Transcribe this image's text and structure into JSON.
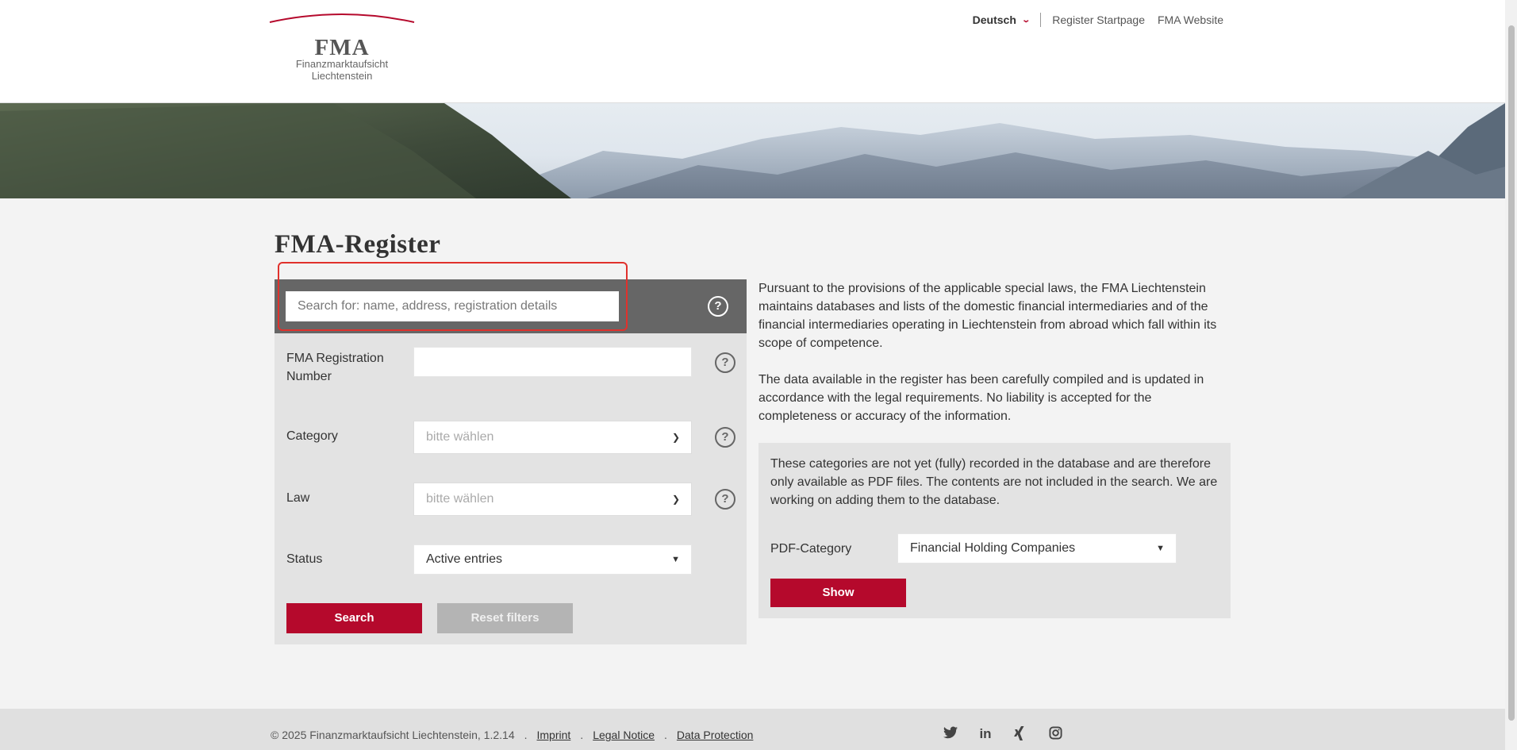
{
  "header": {
    "logo_text": "FMA",
    "logo_subtitle_line1": "Finanzmarktaufsicht",
    "logo_subtitle_line2": "Liechtenstein",
    "language": "Deutsch",
    "nav": [
      "Register Startpage",
      "FMA Website"
    ]
  },
  "main": {
    "title": "FMA-Register",
    "search": {
      "placeholder": "Search for: name, address, registration details",
      "value": ""
    },
    "filters": {
      "registration_label": "FMA Registration Number",
      "registration_value": "",
      "category_label": "Category",
      "category_value": "bitte wählen",
      "law_label": "Law",
      "law_value": "bitte wählen",
      "status_label": "Status",
      "status_value": "Active entries",
      "search_button": "Search",
      "reset_button": "Reset filters"
    },
    "info": {
      "paragraph1": "Pursuant to the provisions of the applicable special laws, the FMA Liechtenstein maintains databases and lists of the domestic financial intermediaries and of the financial intermediaries operating in Liechtenstein from abroad which fall within its scope of competence.",
      "paragraph2": "The data available in the register has been carefully compiled and is updated in accordance with the legal requirements. No liability is accepted for the completeness or accuracy of the information."
    },
    "pdf": {
      "text": "These categories are not yet (fully) recorded in the database and are therefore only available as PDF files. The contents are not included in the search. We are working on adding them to the database.",
      "label": "PDF-Category",
      "value": "Financial Holding Companies",
      "show_button": "Show"
    }
  },
  "footer": {
    "copyright": "© 2025 Finanzmarktaufsicht Liechtenstein, 1.2.14",
    "links": [
      "Imprint",
      "Legal Notice",
      "Data Protection"
    ],
    "social_icons": [
      "twitter-icon",
      "linkedin-icon",
      "xing-icon",
      "instagram-icon"
    ]
  },
  "colors": {
    "accent": "#b5092c",
    "search_bar": "#666666",
    "panel": "#e3e3e3"
  }
}
